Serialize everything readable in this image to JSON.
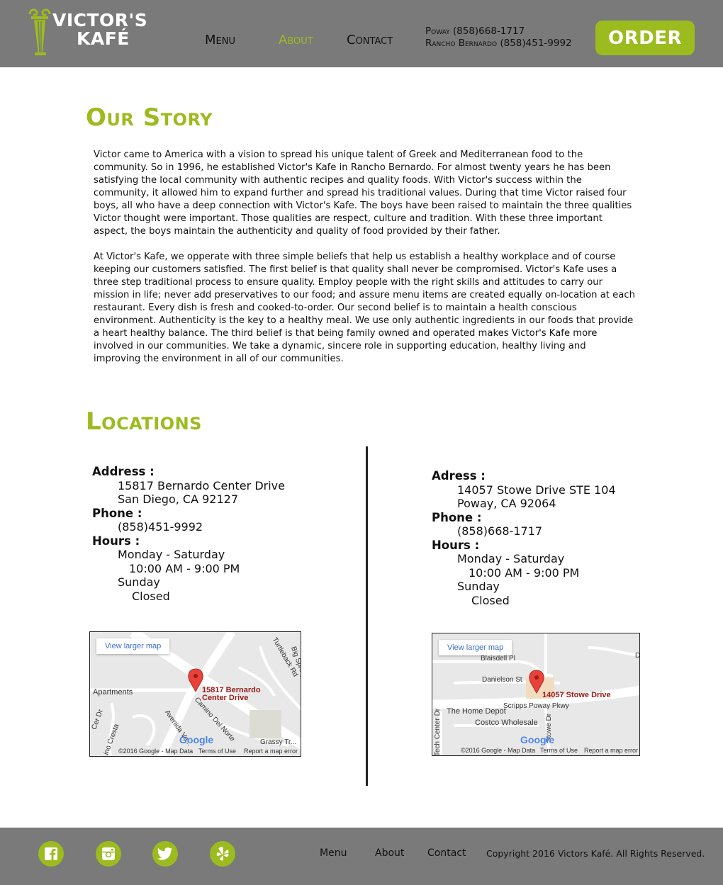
{
  "header": {
    "logo_line1": "VICTOR'S",
    "logo_line2": "KAFÉ",
    "nav": [
      {
        "label": "Menu"
      },
      {
        "label": "About",
        "active": true
      },
      {
        "label": "Contact"
      }
    ],
    "phones": [
      "Poway (858)668-1717",
      "Rancho Bernardo (858)451-9992"
    ],
    "order_label": "ORDER"
  },
  "story": {
    "title": "Our Story",
    "paragraphs": [
      "Victor came to America with a vision to spread his unique talent of Greek and Mediterranean food to the community. So in 1996, he established Victor's Kafe in Rancho Bernardo. For almost twenty years he has been satisfying the local community with authentic recipes and quality foods. With Victor's success within the community, it allowed him to expand further and spread his traditional values. During that time Victor raised four boys, all who have a deep connection with Victor's Kafe. The boys have been raised to maintain the three qualities Victor thought were important. Those qualities are respect, culture and tradition. With these three important aspect, the boys maintain the authenticity and quality of food provided by their father.",
      "At Victor's Kafe, we opperate with three simple beliefs that help us establish a healthy workplace and of course keeping our customers satisfied. The first belief is that quality shall never be compromised. Victor's Kafe uses a three step traditional process to ensure quality. Employ people with the right skills and attitudes to carry our mission in life; never add preservatives to our food; and assure menu items are created equally on-location at each restaurant. Every dish is fresh and cooked-to-order. Our second belief is to maintain a health conscious environment. Authenticity is the key to a healthy meal. We use only authentic ingredients in our foods that provide a heart healthy balance. The third belief is that being family owned and operated makes Victor's Kafe more involved in our communities. We take a dynamic, sincere role in supporting education, healthy living and improving the environment in all of our communities."
    ]
  },
  "locations": {
    "title": "Locations",
    "items": [
      {
        "address_label": "Address :",
        "address_line1": "15817 Bernardo Center Drive",
        "address_line2": "San Diego, CA 92127",
        "phone_label": "Phone :",
        "phone": "(858)451-9992",
        "hours_label": "Hours :",
        "weekday_label": "Monday - Saturday",
        "weekday_hours": "10:00 AM - 9:00 PM",
        "sunday_label": "Sunday",
        "sunday_hours": "Closed",
        "map": {
          "larger_label": "View larger map",
          "pin_label_1": "15817 Bernardo",
          "pin_label_2": "Center Drive",
          "street_labels": [
            "Apartments",
            "Camino Del Norte",
            "Avenida Ve...",
            "Turtleback Rd",
            "Big Springs Way",
            "Grassy Tr...",
            "Cer Dr",
            "...ino Cresta"
          ],
          "google": "Google",
          "attribution": [
            "©2016 Google - Map Data",
            "Terms of Use",
            "Report a map error"
          ]
        }
      },
      {
        "address_label": "Adress :",
        "address_line1": "14057 Stowe Drive STE 104",
        "address_line2": "Poway, CA 92064",
        "phone_label": "Phone :",
        "phone": "(858)668-1717",
        "hours_label": "Hours :",
        "weekday_label": "Monday - Saturday",
        "weekday_hours": "10:00 AM - 9:00 PM",
        "sunday_label": "Sunday",
        "sunday_hours": "Closed",
        "map": {
          "larger_label": "View larger map",
          "pin_label_1": "14057 Stowe Drive",
          "street_labels": [
            "Blaisdell Pl",
            "Danielson St",
            "Scripps Poway Pkwy",
            "The Home Depot",
            "Costco Wholesale",
            "Stowe Dr",
            "Tech Center Dr",
            "D"
          ],
          "google": "Google",
          "attribution": [
            "©2016 Google - Map Data",
            "Terms of Use",
            "Report a map error"
          ]
        }
      }
    ]
  },
  "footer": {
    "social": [
      "facebook-icon",
      "instagram-icon",
      "twitter-icon",
      "yelp-icon"
    ],
    "links": [
      "Menu",
      "About",
      "Contact"
    ],
    "copyright": "Copyright 2016 Victors Kafé. All Rights Reserved."
  },
  "colors": {
    "accent": "#9cbb1e",
    "header_bg": "#7a7a7a",
    "footer_bg": "#7a7a7a",
    "text": "#111111",
    "pin": "#e8423b"
  }
}
